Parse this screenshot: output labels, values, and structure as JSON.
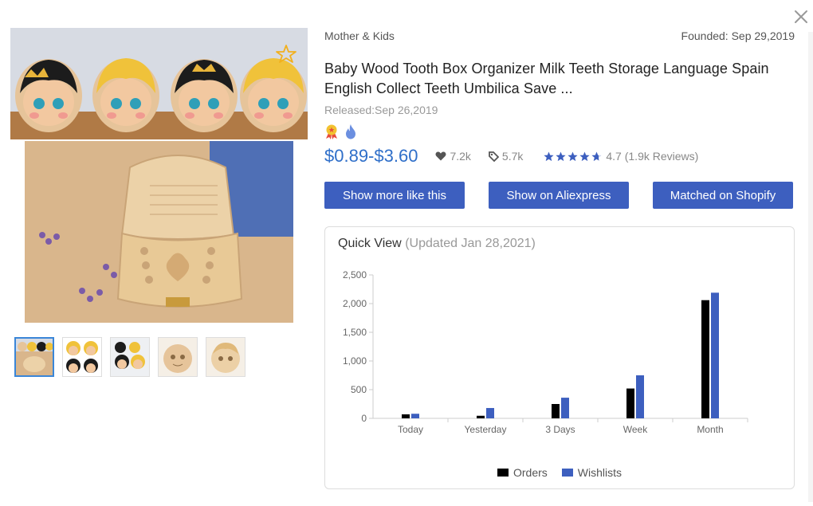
{
  "product": {
    "category": "Mother & Kids",
    "founded": "Founded: Sep 29,2019",
    "title": "Baby Wood Tooth Box Organizer Milk Teeth Storage Language Spain English Collect Teeth Umbilica Save ...",
    "released": "Released:Sep 26,2019",
    "price": "$0.89-$3.60",
    "likes": "7.2k",
    "tags": "5.7k",
    "rating_value": 4.7,
    "rating_text": "4.7 (1.9k Reviews)"
  },
  "icons": {
    "close": "close-icon",
    "favorite": "star-outline-icon",
    "badge_award": "award-ribbon-icon",
    "badge_hot": "flame-icon",
    "likes": "heart-icon",
    "tags": "tag-icon",
    "rating": "star-icon"
  },
  "buttons": {
    "more_like": "Show more like this",
    "aliexpress": "Show on Aliexpress",
    "shopify": "Matched on Shopify"
  },
  "gallery": {
    "thumb_count": 5,
    "active_index": 0
  },
  "quick_view": {
    "title": "Quick View",
    "updated": "(Updated Jan 28,2021)"
  },
  "colors": {
    "accent": "#3d5fbf",
    "price": "#2f6fc9",
    "orders": "#000000",
    "wishlists": "#3d5fbf",
    "star": "#3d5fbf",
    "fav_star": "#f2b01e"
  },
  "chart_data": {
    "type": "bar",
    "categories": [
      "Today",
      "Yesterday",
      "3 Days",
      "Week",
      "Month"
    ],
    "series": [
      {
        "name": "Orders",
        "values": [
          70,
          45,
          250,
          520,
          2060
        ]
      },
      {
        "name": "Wishlists",
        "values": [
          80,
          180,
          360,
          750,
          2190
        ]
      }
    ],
    "ylim": [
      0,
      2500
    ],
    "yticks": [
      "0",
      "500",
      "1,000",
      "1,500",
      "2,000",
      "2,500"
    ],
    "grid": false,
    "legend": "bottom-center"
  }
}
